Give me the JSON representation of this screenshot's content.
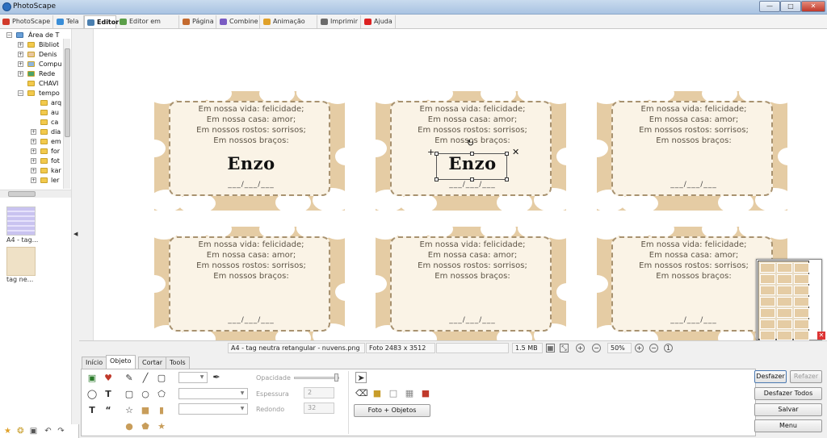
{
  "window": {
    "title": "PhotoScape"
  },
  "tabs": [
    {
      "label": "PhotoScape",
      "color": "#d23b2b"
    },
    {
      "label": "Tela",
      "color": "#3a8ed8"
    },
    {
      "label": "Editor",
      "color": "#4a7fb0",
      "active": true
    },
    {
      "label": "Editor em lotes",
      "color": "#5a9e49"
    },
    {
      "label": "Página",
      "color": "#c46a2f"
    },
    {
      "label": "Combine",
      "color": "#7a5cc3"
    },
    {
      "label": "Animação Gif",
      "color": "#e0a12a"
    },
    {
      "label": "Imprimir",
      "color": "#6b6b6b"
    },
    {
      "label": "Ajuda",
      "color": "#d22"
    }
  ],
  "tree": {
    "items": [
      {
        "label": "Área de T",
        "level": 0
      },
      {
        "label": "Bibliot",
        "level": 1
      },
      {
        "label": "Denis",
        "level": 1
      },
      {
        "label": "Compu",
        "level": 1
      },
      {
        "label": "Rede",
        "level": 1
      },
      {
        "label": "CHAVI",
        "level": 1
      },
      {
        "label": "tempo",
        "level": 1
      },
      {
        "label": "arq",
        "level": 2
      },
      {
        "label": "au",
        "level": 2
      },
      {
        "label": "ca",
        "level": 2
      },
      {
        "label": "dia",
        "level": 2
      },
      {
        "label": "em",
        "level": 2
      },
      {
        "label": "for",
        "level": 2
      },
      {
        "label": "fot",
        "level": 2
      },
      {
        "label": "kar",
        "level": 2
      },
      {
        "label": "ler",
        "level": 2
      },
      {
        "label": "...",
        "level": 2
      }
    ]
  },
  "files": [
    {
      "label": "A4 - tag..."
    },
    {
      "label": "tag ne..."
    }
  ],
  "card": {
    "lines": [
      "Em nossa vida: felicidade;",
      "Em nossa casa: amor;",
      "Em nossos rostos: sorrisos;",
      "Em nossos braços:"
    ],
    "name": "Enzo",
    "date": "___/___/___"
  },
  "status": {
    "filename": "A4 - tag neutra retangular - nuvens.png",
    "dimensions": "Foto 2483 x 3512",
    "filesize": "1.5 MB",
    "zoom": "50%"
  },
  "bottom": {
    "tabs": [
      "Início",
      "Objeto",
      "Cortar",
      "Tools"
    ],
    "active_tab": "Objeto",
    "opacity_label": "Opacidade",
    "thickness_label": "Espessura",
    "thickness_value": "2",
    "round_label": "Redondo",
    "round_value": "32",
    "photo_objects_button": "Foto + Objetos",
    "undo_button": "Desfazer",
    "redo_button": "Refazer",
    "undo_all_button": "Desfazer Todos",
    "save_button": "Salvar",
    "menu_button": "Menu"
  }
}
